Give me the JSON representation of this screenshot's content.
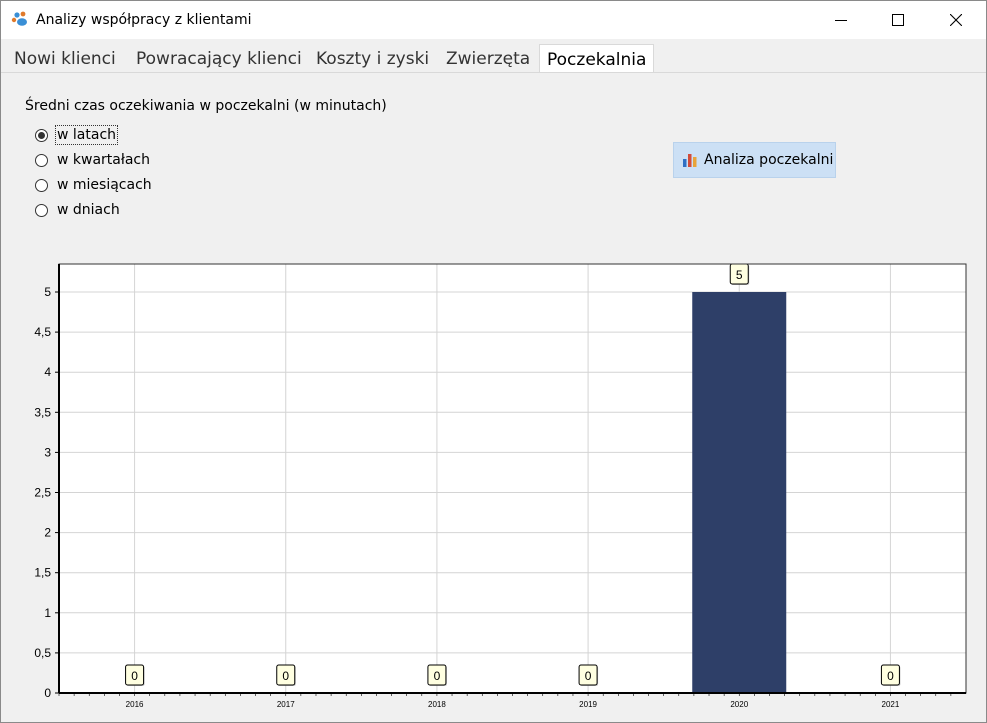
{
  "window": {
    "title": "Analizy współpracy z klientami"
  },
  "tabs": [
    {
      "label": "Nowi klienci"
    },
    {
      "label": "Powracający klienci"
    },
    {
      "label": "Koszty i zyski"
    },
    {
      "label": "Zwierzęta"
    },
    {
      "label": "Poczekalnia",
      "active": true
    }
  ],
  "panel": {
    "heading": "Średni czas oczekiwania w poczekalni (w minutach)",
    "radios": [
      {
        "label": "w latach",
        "checked": true
      },
      {
        "label": "w kwartałach",
        "checked": false
      },
      {
        "label": "w miesiącach",
        "checked": false
      },
      {
        "label": "w dniach",
        "checked": false
      }
    ],
    "action_button": {
      "label": "Analiza poczekalni",
      "icon": "bar-chart-icon"
    }
  },
  "colors": {
    "bar": "#2e3f68",
    "button_bg": "#cce0f5",
    "label_box": "#ffffe1"
  },
  "chart_data": {
    "type": "bar",
    "categories": [
      "2016",
      "2017",
      "2018",
      "2019",
      "2020",
      "2021"
    ],
    "values": [
      0,
      0,
      0,
      0,
      5,
      0
    ],
    "data_labels": [
      "0",
      "0",
      "0",
      "0",
      "5",
      "0"
    ],
    "ylim": [
      0,
      5
    ],
    "yticks": [
      "0",
      "0,5",
      "1",
      "1,5",
      "2",
      "2,5",
      "3",
      "3,5",
      "4",
      "4,5",
      "5"
    ],
    "grid": true,
    "title": "",
    "xlabel": "",
    "ylabel": ""
  }
}
